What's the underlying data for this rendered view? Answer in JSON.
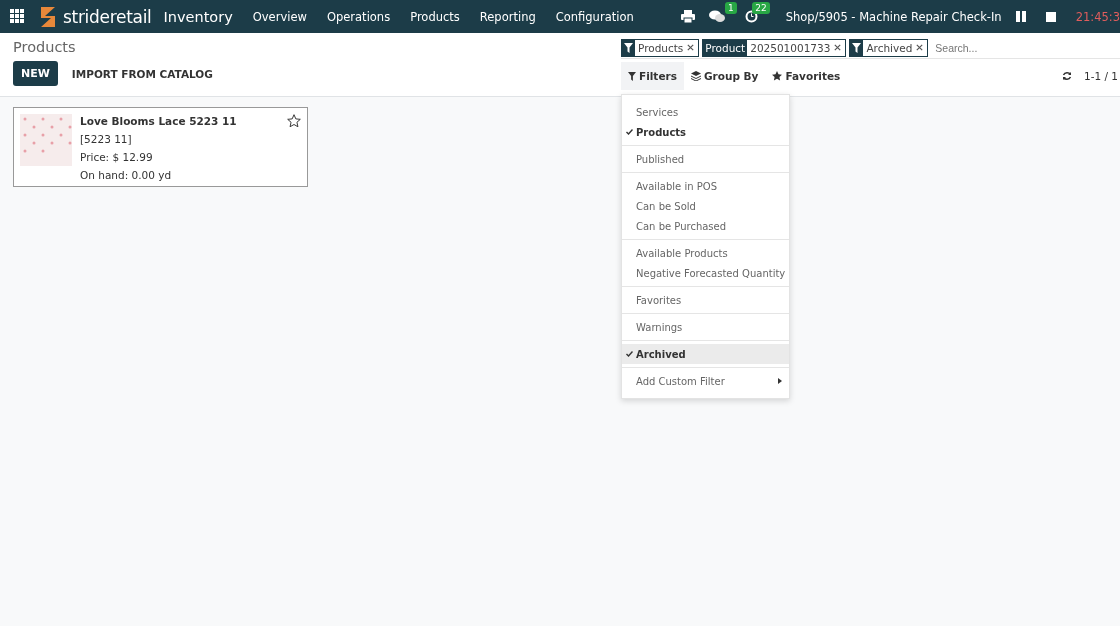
{
  "navbar": {
    "brand": "strideretail",
    "app": "Inventory",
    "menu": [
      "Overview",
      "Operations",
      "Products",
      "Reporting",
      "Configuration"
    ],
    "messages_badge": "1",
    "activities_badge": "22",
    "company": "Shop/5905 - Machine Repair Check-In",
    "clock": "21:45:3"
  },
  "breadcrumb": "Products",
  "buttons": {
    "new": "NEW",
    "import": "IMPORT FROM CATALOG"
  },
  "facets": [
    {
      "kind": "filter",
      "values": "Products"
    },
    {
      "kind": "field",
      "label": "Product",
      "values": "202501001733"
    },
    {
      "kind": "filter",
      "values": "Archived"
    }
  ],
  "search": {
    "placeholder": "Search..."
  },
  "toggles": [
    {
      "label": "Filters",
      "selected": true
    },
    {
      "label": "Group By",
      "selected": false
    },
    {
      "label": "Favorites",
      "selected": false
    }
  ],
  "pager": "1-1 / 1",
  "filter_menu": [
    [
      {
        "label": "Services",
        "checked": false
      },
      {
        "label": "Products",
        "checked": true
      }
    ],
    [
      {
        "label": "Published",
        "checked": false
      }
    ],
    [
      {
        "label": "Available in POS",
        "checked": false
      },
      {
        "label": "Can be Sold",
        "checked": false
      },
      {
        "label": "Can be Purchased",
        "checked": false
      }
    ],
    [
      {
        "label": "Available Products",
        "checked": false
      },
      {
        "label": "Negative Forecasted Quantity",
        "checked": false
      }
    ],
    [
      {
        "label": "Favorites",
        "checked": false
      }
    ],
    [
      {
        "label": "Warnings",
        "checked": false
      }
    ],
    [
      {
        "label": "Archived",
        "checked": true
      }
    ]
  ],
  "custom_filter": "Add Custom Filter",
  "cards": [
    {
      "name": "Love Blooms Lace 5223 11",
      "code": "[5223 11]",
      "price": "Price: $ 12.99",
      "on_hand": "On hand: 0.00 yd",
      "favorite": false
    }
  ]
}
